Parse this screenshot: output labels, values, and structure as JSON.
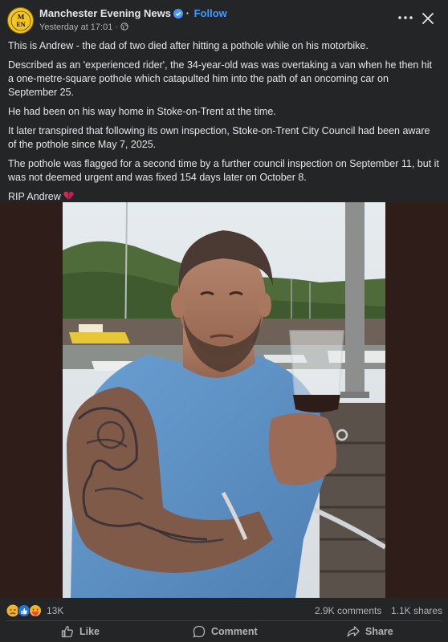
{
  "post": {
    "page_name": "Manchester Evening News",
    "avatar_text": "MEN",
    "follow_label": "Follow",
    "timestamp": "Yesterday at 17:01",
    "separator": "·"
  },
  "body": {
    "paragraphs": [
      "This is Andrew - the dad of two died after hitting a pothole while on his motorbike.",
      "Described as an 'experienced rider', the 34-year-old was was overtaking a van when he then hit a one-metre-square pothole which catapulted him into the path of an oncoming car on September 25.",
      "He had been on his way home in Stoke-on-Trent at the time.",
      "It later transpired that following its own inspection, Stoke-on-Trent City Council had been aware of the pothole since May 7, 2025.",
      "The pothole was flagged for a second time by a further council inspection on September 11, but it was not deemed urgent and was fixed 154 days later on October 8.",
      "RIP Andrew"
    ]
  },
  "stats": {
    "reactions_count": "13K",
    "comments": "2.9K comments",
    "shares": "1.1K shares"
  },
  "actions": {
    "like": "Like",
    "comment": "Comment",
    "share": "Share"
  },
  "colors": {
    "background": "#242526",
    "text": "#e4e6eb",
    "muted": "#b0b3b8",
    "link": "#4599ff",
    "photo_backdrop": "#2e1d18"
  }
}
